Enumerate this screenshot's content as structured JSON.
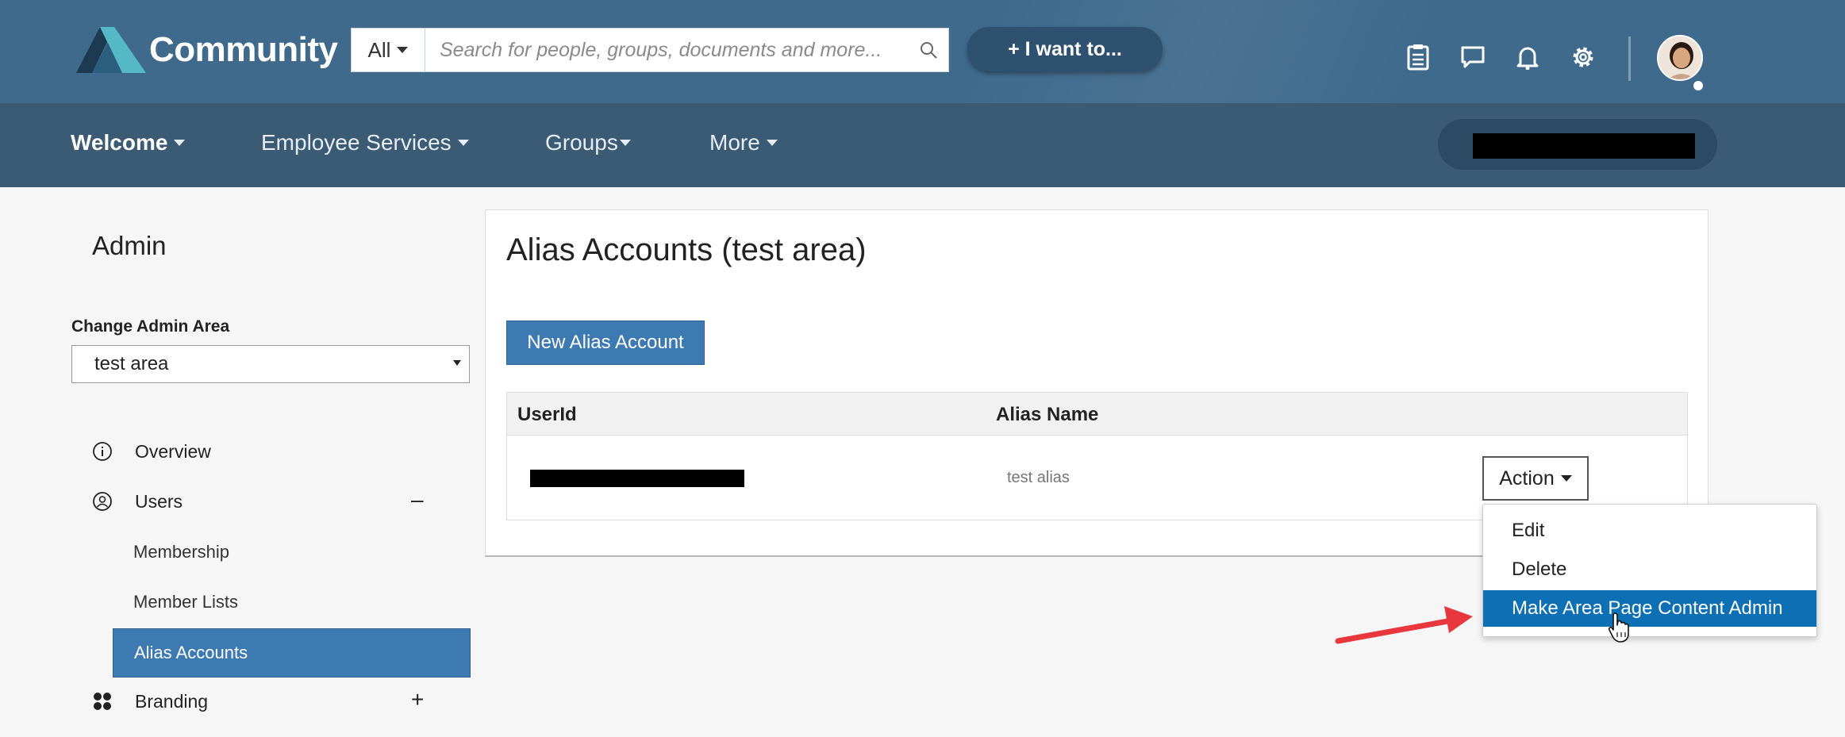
{
  "header": {
    "logo_text": "Community",
    "search_scope": "All",
    "search_placeholder": "Search for people, groups, documents and more...",
    "iwant_label": "+ I want to...",
    "icons": [
      "clipboard-icon",
      "chat-icon",
      "bell-icon",
      "gear-icon"
    ]
  },
  "nav": {
    "items": [
      {
        "label": "Welcome",
        "active": true
      },
      {
        "label": "Employee Services",
        "active": false
      },
      {
        "label": "Groups",
        "active": false
      },
      {
        "label": "More",
        "active": false
      }
    ]
  },
  "sidebar": {
    "title": "Admin",
    "area_label": "Change Admin Area",
    "area_value": "test area",
    "overview": "Overview",
    "users": "Users",
    "users_toggle": "–",
    "membership": "Membership",
    "member_lists": "Member Lists",
    "alias_accounts": "Alias Accounts",
    "branding": "Branding",
    "branding_toggle": "+"
  },
  "main": {
    "title": "Alias Accounts (test area)",
    "new_button": "New Alias Account",
    "columns": [
      "UserId",
      "Alias Name"
    ],
    "rows": [
      {
        "alias_name": "test alias",
        "action_label": "Action"
      }
    ]
  },
  "dropdown": {
    "items": [
      "Edit",
      "Delete",
      "Make Area Page Content Admin"
    ],
    "highlighted_index": 2
  },
  "colors": {
    "header_bg": "#3f6a8c",
    "nav_bg": "#3b5a74",
    "accent_blue": "#3d7ab2",
    "highlight_blue": "#0d6fb4",
    "annotation_red": "#e8383d"
  }
}
